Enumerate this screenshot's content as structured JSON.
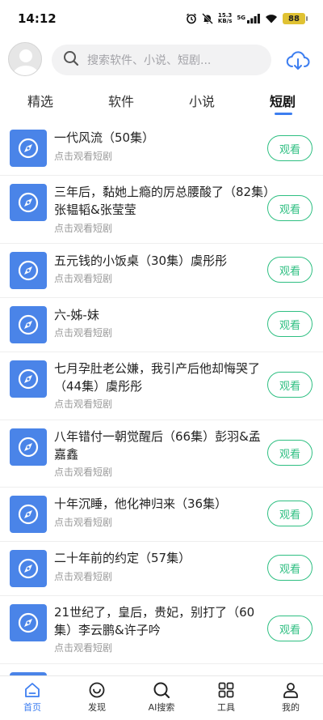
{
  "status_bar": {
    "time": "14:12",
    "net_speed_value": "15.3",
    "net_speed_unit": "KB/s",
    "signal_label": "5G",
    "battery": "88"
  },
  "search": {
    "placeholder": "搜索软件、小说、短剧..."
  },
  "tabs": [
    {
      "label": "精选",
      "active": false
    },
    {
      "label": "软件",
      "active": false
    },
    {
      "label": "小说",
      "active": false
    },
    {
      "label": "短剧",
      "active": true
    }
  ],
  "items": [
    {
      "title": "一代风流（50集）",
      "subtitle": "点击观看短剧",
      "button": "观看"
    },
    {
      "title": "三年后，黏她上瘾的厉总腰酸了（82集）张韫韬&张莹莹",
      "subtitle": "点击观看短剧",
      "button": "观看"
    },
    {
      "title": "五元钱的小饭桌（30集）虞彤彤",
      "subtitle": "点击观看短剧",
      "button": "观看"
    },
    {
      "title": "六-姊-妹",
      "subtitle": "点击观看短剧",
      "button": "观看"
    },
    {
      "title": "七月孕肚老公嫌，我引产后他却悔哭了（44集）虞彤彤",
      "subtitle": "点击观看短剧",
      "button": "观看"
    },
    {
      "title": "八年错付一朝觉醒后（66集）彭羽&孟嘉鑫",
      "subtitle": "点击观看短剧",
      "button": "观看"
    },
    {
      "title": "十年沉睡，他化神归来（36集）",
      "subtitle": "点击观看短剧",
      "button": "观看"
    },
    {
      "title": "二十年前的约定（57集）",
      "subtitle": "点击观看短剧",
      "button": "观看"
    },
    {
      "title": "21世纪了，皇后，贵妃，别打了（60集）李云鹏&许子吟",
      "subtitle": "点击观看短剧",
      "button": "观看"
    }
  ],
  "bottom_nav": [
    {
      "label": "首页",
      "icon": "home-icon",
      "active": true
    },
    {
      "label": "发现",
      "icon": "discover-icon",
      "active": false
    },
    {
      "label": "AI搜索",
      "icon": "search-icon",
      "active": false
    },
    {
      "label": "工具",
      "icon": "grid-icon",
      "active": false
    },
    {
      "label": "我的",
      "icon": "user-icon",
      "active": false
    }
  ],
  "colors": {
    "accent": "#3d7ef0",
    "watch_button": "#2fbf82",
    "thumb": "#4a84e8"
  }
}
